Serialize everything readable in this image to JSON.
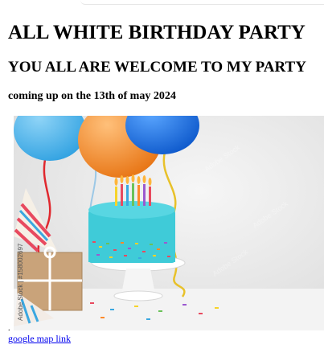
{
  "page": {
    "title": "ALL WHITE BIRTHDAY PARTY",
    "subtitle": "YOU ALL ARE WELCOME TO MY PARTY",
    "date_line": "coming up on the 13th of may 2024"
  },
  "image": {
    "watermark": "Adobe Stock | #158002697",
    "colors": {
      "cake": "#3fcbd8",
      "balloon_blue": "#2c9fe0",
      "balloon_orange": "#f08a1e",
      "background": "#ececec"
    }
  },
  "link": {
    "label": "google map link"
  }
}
